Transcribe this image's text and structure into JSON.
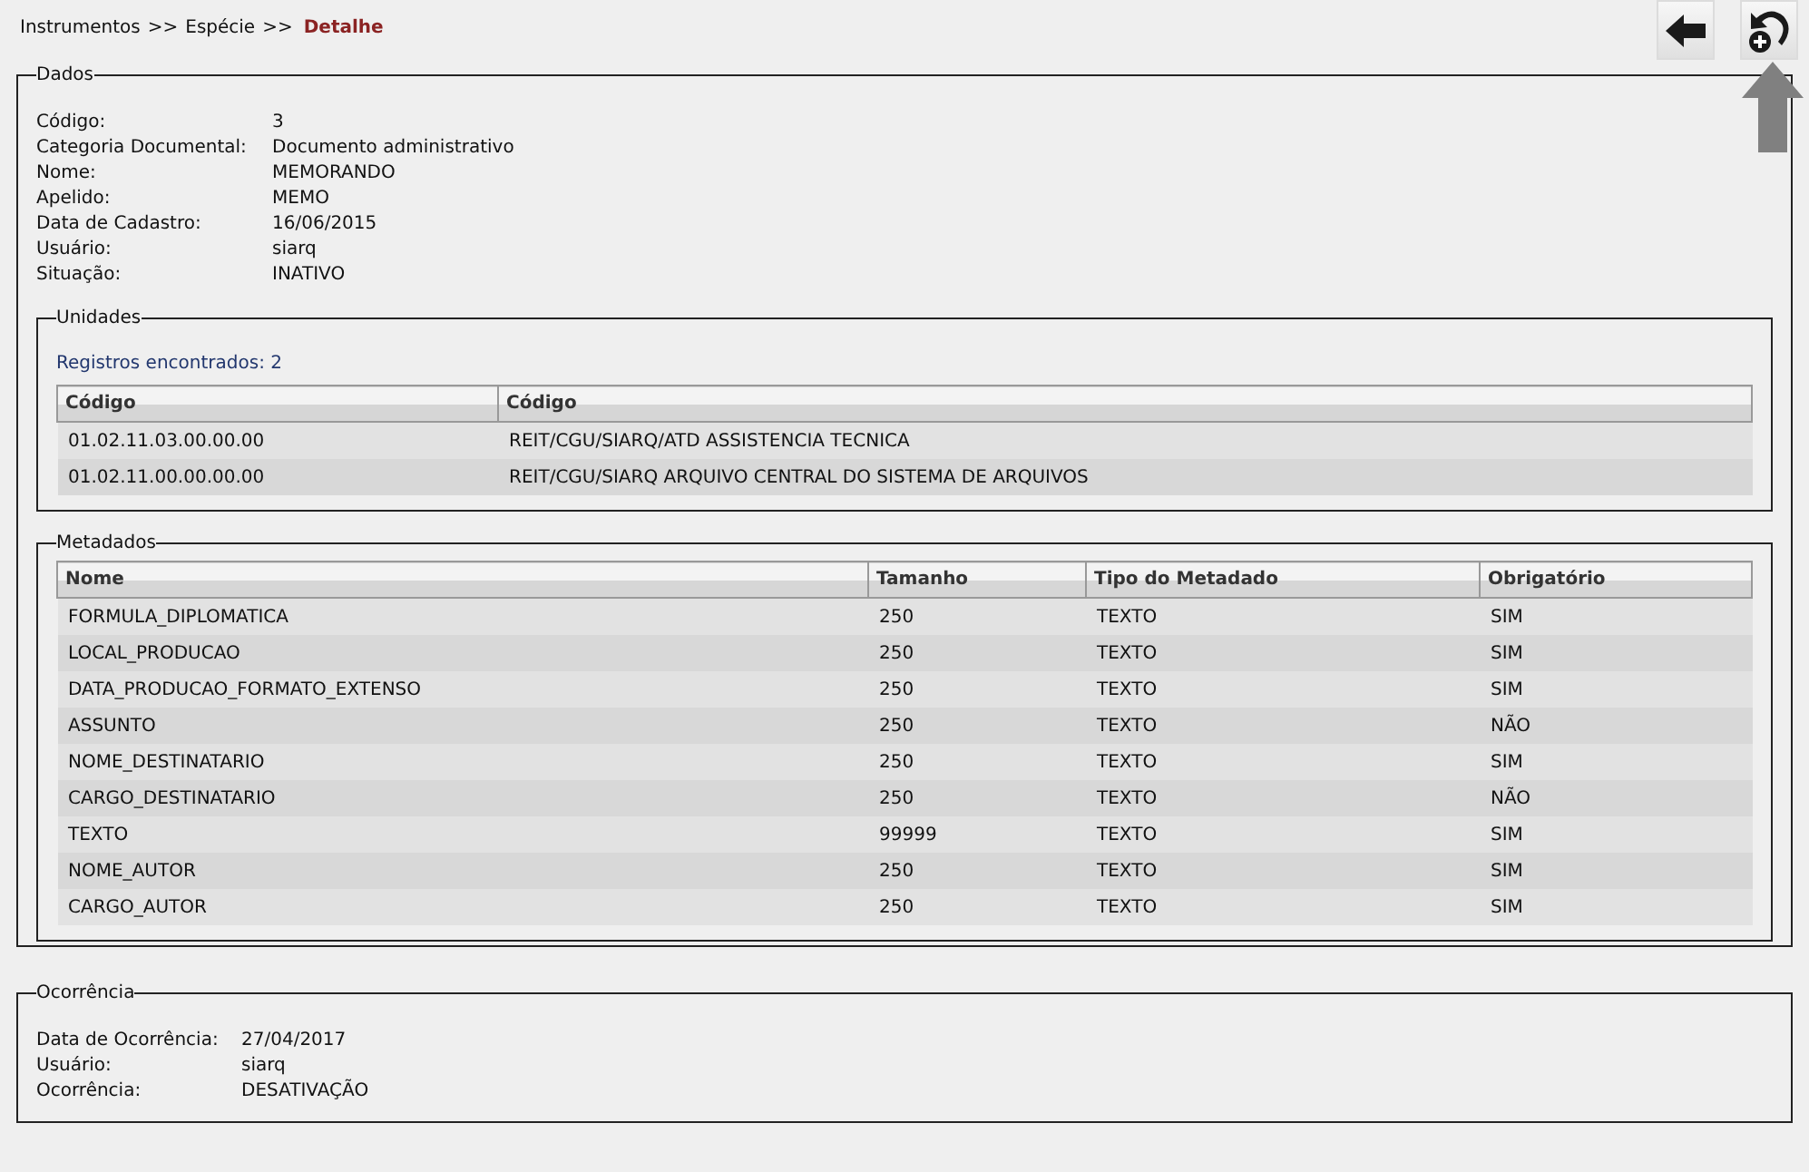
{
  "breadcrumb": {
    "items": [
      "Instrumentos",
      "Espécie"
    ],
    "separator": ">>",
    "current": "Detalhe"
  },
  "dados": {
    "legend": "Dados",
    "fields": [
      {
        "label": "Código:",
        "value": "3"
      },
      {
        "label": "Categoria Documental:",
        "value": "Documento administrativo"
      },
      {
        "label": "Nome:",
        "value": "MEMORANDO"
      },
      {
        "label": "Apelido:",
        "value": "MEMO"
      },
      {
        "label": "Data de Cadastro:",
        "value": "16/06/2015"
      },
      {
        "label": "Usuário:",
        "value": "siarq"
      },
      {
        "label": "Situação:",
        "value": "INATIVO"
      }
    ]
  },
  "unidades": {
    "legend": "Unidades",
    "count": "Registros encontrados: 2",
    "columns": [
      "Código",
      "Código"
    ],
    "rows": [
      [
        "01.02.11.03.00.00.00",
        "REIT/CGU/SIARQ/ATD ASSISTENCIA TECNICA"
      ],
      [
        "01.02.11.00.00.00.00",
        "REIT/CGU/SIARQ ARQUIVO CENTRAL DO SISTEMA DE ARQUIVOS"
      ]
    ]
  },
  "metadados": {
    "legend": "Metadados",
    "columns": [
      "Nome",
      "Tamanho",
      "Tipo do Metadado",
      "Obrigatório"
    ],
    "rows": [
      [
        "FORMULA_DIPLOMATICA",
        "250",
        "TEXTO",
        "SIM"
      ],
      [
        "LOCAL_PRODUCAO",
        "250",
        "TEXTO",
        "SIM"
      ],
      [
        "DATA_PRODUCAO_FORMATO_EXTENSO",
        "250",
        "TEXTO",
        "SIM"
      ],
      [
        "ASSUNTO",
        "250",
        "TEXTO",
        "NÃO"
      ],
      [
        "NOME_DESTINATARIO",
        "250",
        "TEXTO",
        "SIM"
      ],
      [
        "CARGO_DESTINATARIO",
        "250",
        "TEXTO",
        "NÃO"
      ],
      [
        "TEXTO",
        "99999",
        "TEXTO",
        "SIM"
      ],
      [
        "NOME_AUTOR",
        "250",
        "TEXTO",
        "SIM"
      ],
      [
        "CARGO_AUTOR",
        "250",
        "TEXTO",
        "SIM"
      ]
    ]
  },
  "ocorrencia": {
    "legend": "Ocorrência",
    "fields": [
      {
        "label": "Data de Ocorrência:",
        "value": "27/04/2017"
      },
      {
        "label": "Usuário:",
        "value": "siarq"
      },
      {
        "label": "Ocorrência:",
        "value": "DESATIVAÇÃO"
      }
    ]
  }
}
